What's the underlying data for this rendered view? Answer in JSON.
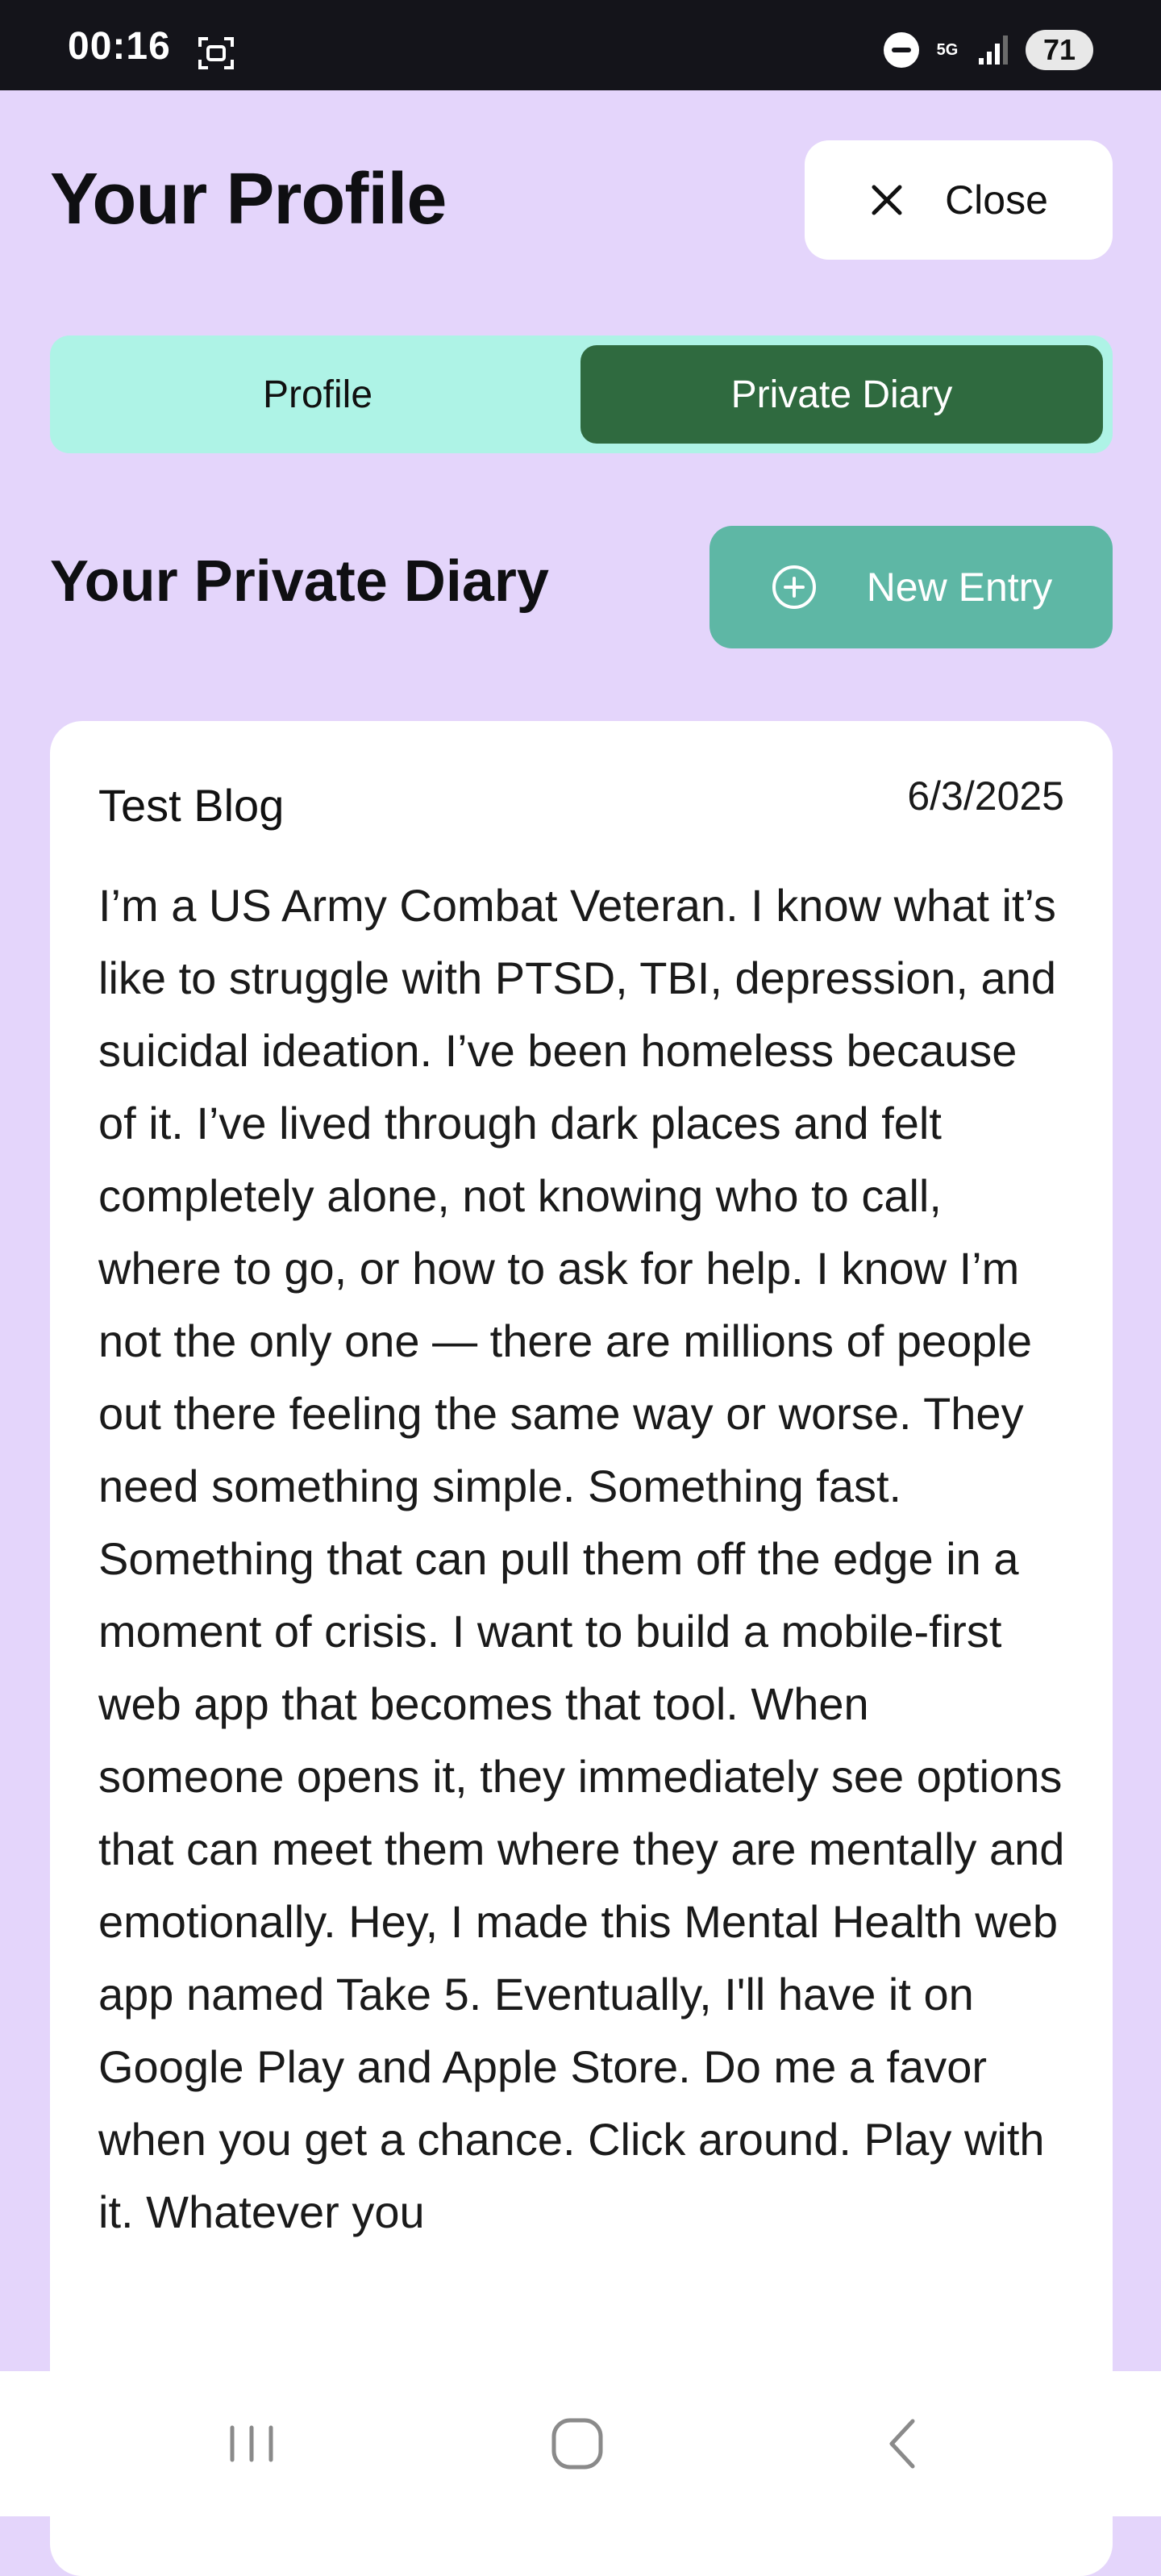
{
  "status_bar": {
    "time": "00:16",
    "network": "5G",
    "battery": "71"
  },
  "header": {
    "title": "Your Profile",
    "close_label": "Close"
  },
  "tabs": [
    {
      "label": "Profile",
      "active": false
    },
    {
      "label": "Private Diary",
      "active": true
    }
  ],
  "section": {
    "title": "Your Private Diary",
    "new_entry_label": "New Entry"
  },
  "entry": {
    "title": "Test Blog",
    "date": "6/3/2025",
    "body": "I’m a US Army Combat Veteran. I know what it’s like to struggle with PTSD, TBI, depression, and suicidal ideation. I’ve been homeless because of it. I’ve lived through dark places and felt completely alone, not knowing who to call, where to go, or how to ask for help. I know I’m not the only one — there are millions of people out there feeling the same way or worse. They need something simple. Something fast. Something that can pull them off the edge in a moment of crisis. I want to build a mobile-first web app that becomes that tool. When someone opens it, they immediately see options that can meet them where they are mentally and emotionally. Hey, I made this Mental Health web app named Take 5. Eventually, I'll have it on Google Play and Apple Store. Do me a favor when you get a chance. Click around. Play with it. Whatever you"
  },
  "colors": {
    "background": "#e4d5fb",
    "tab_bar": "#aef3e6",
    "active_tab": "#2f6a3f",
    "new_entry_button": "#5eb7a5"
  },
  "icons": {
    "close": "close-icon",
    "new_entry": "plus-circle-icon",
    "nav_recent": "recent-apps-icon",
    "nav_home": "home-icon",
    "nav_back": "back-icon"
  }
}
